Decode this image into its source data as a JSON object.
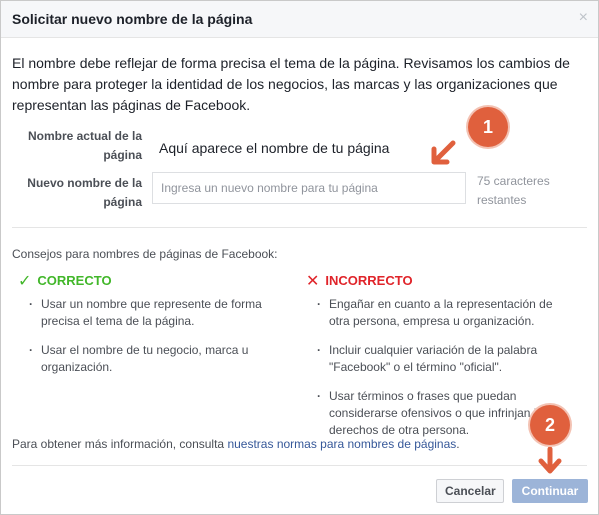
{
  "dialog": {
    "title": "Solicitar nuevo nombre de la página",
    "close_glyph": "×",
    "intro": "El nombre debe reflejar de forma precisa el tema de la página. Revisamos los cambios de nombre para proteger la identidad de los negocios, las marcas y las organizaciones que representan las páginas de Facebook."
  },
  "form": {
    "current_label": "Nombre actual de la página",
    "current_value": "Aquí aparece el nombre de tu página",
    "new_label": "Nuevo nombre de la página",
    "new_placeholder": "Ingresa un nuevo nombre para tu página",
    "new_value": "",
    "chars_remaining": "75 caracteres restantes"
  },
  "tips": {
    "title": "Consejos para nombres de páginas de Facebook:",
    "correct": {
      "mark": "✓",
      "heading": "CORRECTO",
      "items": [
        "Usar un nombre que represente de forma precisa el tema de la página.",
        "Usar el nombre de tu negocio, marca u organización."
      ]
    },
    "incorrect": {
      "mark": "✕",
      "heading": "INCORRECTO",
      "items": [
        "Engañar en cuanto a la representación de otra persona, empresa u organización.",
        "Incluir cualquier variación de la palabra \"Facebook\" o el término \"oficial\".",
        "Usar términos o frases que puedan considerarse ofensivos o que infrinjan los derechos de otra persona."
      ]
    }
  },
  "more_info": {
    "text": "Para obtener más información, consulta ",
    "link": "nuestras normas para nombres de páginas",
    "suffix": "."
  },
  "buttons": {
    "cancel": "Cancelar",
    "continue": "Continuar"
  },
  "annotations": {
    "badge_1": "1",
    "badge_2": "2"
  },
  "colors": {
    "correct": "#42b72a",
    "incorrect": "#e0242a",
    "link": "#365899",
    "badge": "#e0603d",
    "continue_disabled": "#9cb4d8"
  }
}
